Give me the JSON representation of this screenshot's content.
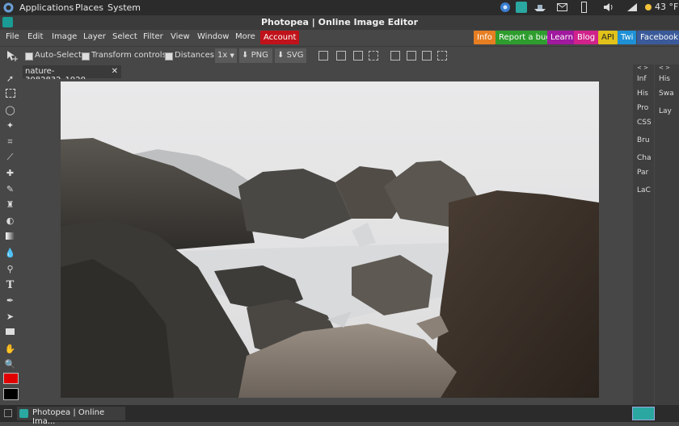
{
  "system_bar": {
    "menus": [
      "Applications",
      "Places",
      "System"
    ],
    "weather": "43 °F"
  },
  "window": {
    "title": "Photopea | Online Image Editor"
  },
  "menubar": {
    "items": [
      "File",
      "Edit",
      "Image",
      "Layer",
      "Select",
      "Filter",
      "View",
      "Window",
      "More"
    ],
    "account": "Account",
    "right_buttons": [
      {
        "label": "Info",
        "color": "#e67e22"
      },
      {
        "label": "Report a bug",
        "color": "#2e9d2e"
      },
      {
        "label": "Learn",
        "color": "#a0199e"
      },
      {
        "label": "Blog",
        "color": "#d0228a"
      },
      {
        "label": "API",
        "color": "#e0c21a"
      },
      {
        "label": "Twi",
        "color": "#1e90d6"
      },
      {
        "label": "Facebook",
        "color": "#3a5a9a"
      }
    ]
  },
  "options": {
    "auto_select": "Auto-Select",
    "transform_controls": "Transform controls",
    "distances": "Distances",
    "zoom": "1x",
    "png": "PNG",
    "svg": "SVG"
  },
  "tab": {
    "name": "nature-3082832_1920...",
    "close": "✕"
  },
  "right_panel_a": [
    "Inf",
    "His",
    "Pro",
    "CSS",
    "Bru",
    "Cha",
    "Par",
    "LaC"
  ],
  "right_panel_b": [
    "His",
    "Swa",
    "Lay"
  ],
  "panel_toggle": "< >",
  "colors": {
    "foreground": "#e00000",
    "background": "#000000"
  },
  "taskbar": {
    "app": "Photopea | Online Ima..."
  }
}
